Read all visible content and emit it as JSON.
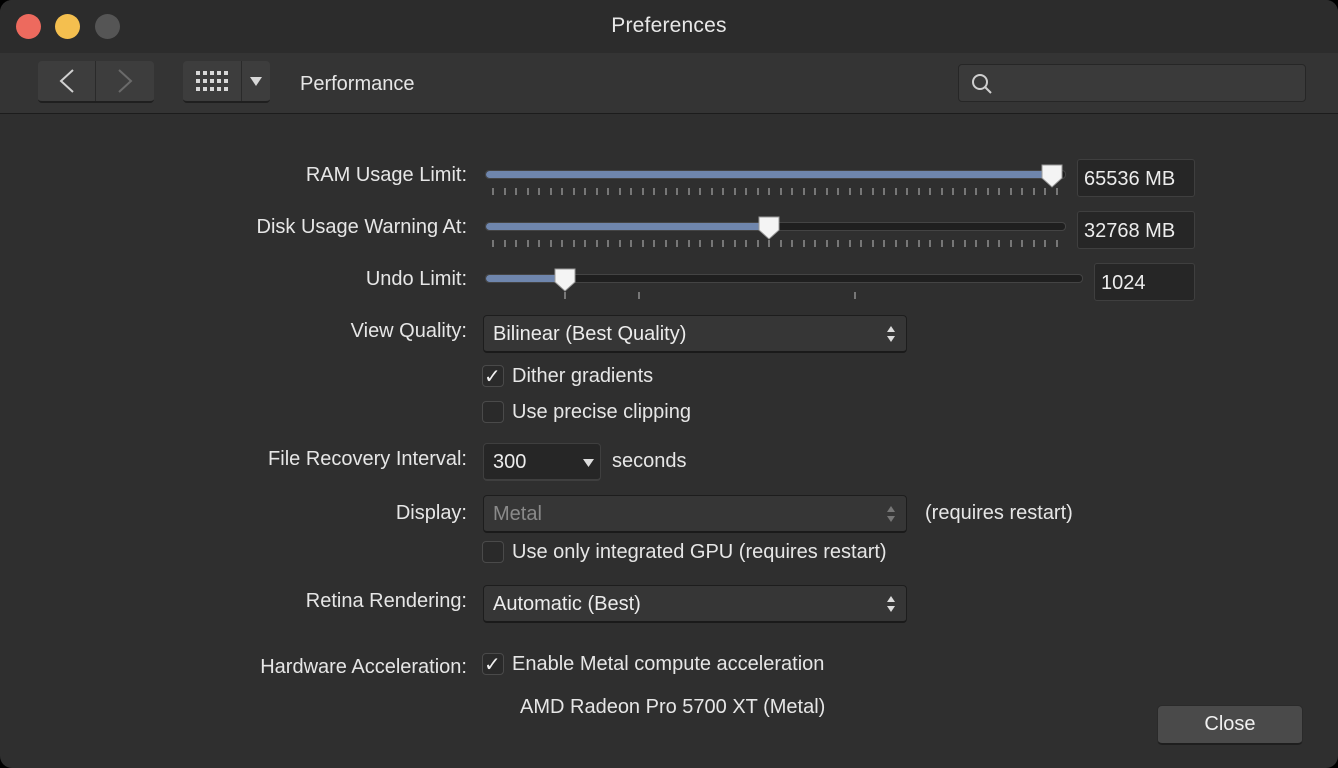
{
  "window": {
    "title": "Preferences"
  },
  "toolbar": {
    "breadcrumb": "Performance",
    "search_placeholder": "",
    "icons": {
      "back": "chevron-left-icon",
      "forward": "chevron-right-icon",
      "grid": "grid-icon",
      "dropdown": "triangle-down-icon",
      "search": "magnifier-icon"
    }
  },
  "settings": {
    "ram": {
      "label": "RAM Usage Limit:",
      "value": "65536 MB",
      "level": 0.98
    },
    "disk": {
      "label": "Disk Usage Warning At:",
      "value": "32768 MB",
      "level": 0.49
    },
    "undo": {
      "label": "Undo Limit:",
      "value": "1024",
      "level": 0.135
    },
    "view_quality": {
      "label": "View Quality:",
      "selected": "Bilinear (Best Quality)"
    },
    "dither": {
      "label": "Dither gradients",
      "checked": true
    },
    "precise_clipping": {
      "label": "Use precise clipping",
      "checked": false
    },
    "file_recovery": {
      "label": "File Recovery Interval:",
      "value": "300",
      "unit": "seconds"
    },
    "display": {
      "label": "Display:",
      "selected": "Metal",
      "note": "(requires restart)",
      "enabled": false
    },
    "integrated_gpu": {
      "label": "Use only integrated GPU (requires restart)",
      "checked": false
    },
    "retina": {
      "label": "Retina Rendering:",
      "selected": "Automatic (Best)"
    },
    "hardware_accel": {
      "label": "Hardware Acceleration:",
      "checkbox_label": "Enable Metal compute acceleration",
      "checked": true,
      "gpu_name": "AMD Radeon Pro 5700 XT (Metal)"
    }
  },
  "buttons": {
    "close": "Close"
  },
  "colors": {
    "accent_fill": "#6f86ad",
    "window_bg": "#2f2f2f"
  }
}
